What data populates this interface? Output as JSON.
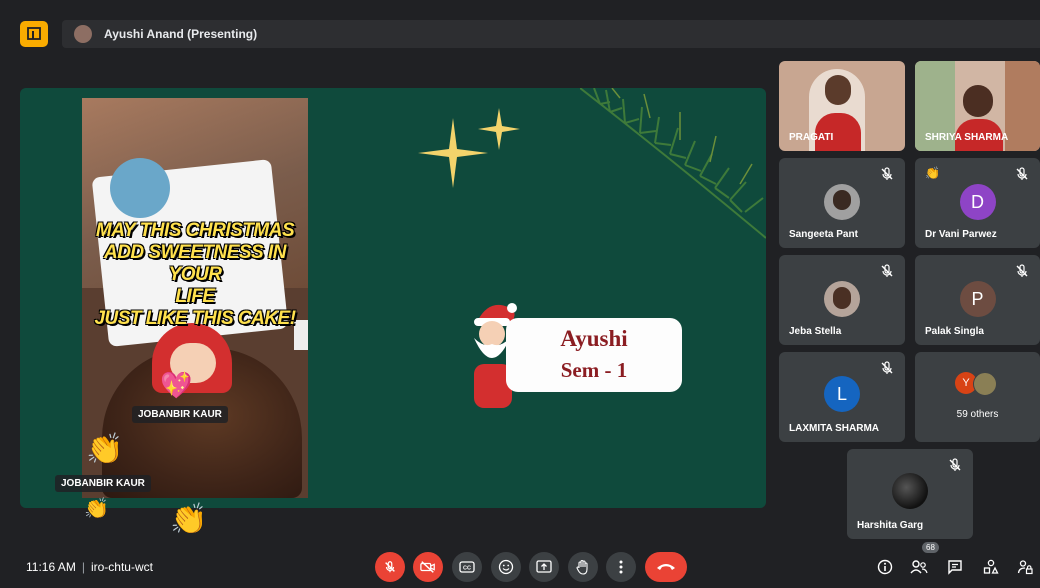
{
  "top": {
    "presenter_label": "Ayushi Anand (Presenting)"
  },
  "slide": {
    "message_lines": [
      "MAY THIS CHRISTMAS",
      "ADD SWEETNESS IN YOUR",
      "LIFE",
      "JUST LIKE THIS CAKE!"
    ],
    "card_line1": "Ayushi",
    "card_line2": "Sem - 1",
    "reaction_name_1": "JOBANBIR KAUR",
    "reaction_name_2": "JOBANBIR KAUR"
  },
  "participants": [
    {
      "name": "PRAGATI",
      "type": "video"
    },
    {
      "name": "SHRIYA SHARMA",
      "type": "video"
    },
    {
      "name": "Sangeeta Pant",
      "type": "photo",
      "muted": true
    },
    {
      "name": "Dr Vani Parwez",
      "type": "initial",
      "initial": "D",
      "color": "#8e44c6",
      "muted": true
    },
    {
      "name": "Jeba Stella",
      "type": "photo",
      "muted": true
    },
    {
      "name": "Palak Singla",
      "type": "initial",
      "initial": "P",
      "color": "#6d4c41",
      "muted": true
    },
    {
      "name": "LAXMITA SHARMA",
      "type": "initial",
      "initial": "L",
      "color": "#1565c0",
      "muted": true
    },
    {
      "name": "59 others",
      "type": "others",
      "initial": "Y",
      "color": "#d84315"
    },
    {
      "name": "Harshita Garg",
      "type": "photo",
      "muted": true
    }
  ],
  "bottom": {
    "time": "11:16 AM",
    "separator": "|",
    "meeting_code": "iro-chtu-wct",
    "people_count": "68"
  },
  "colors": {
    "slide_bg": "#0f4a3c",
    "danger": "#ea4335",
    "tile_bg": "#3c4043",
    "logo": "#f9ab00"
  }
}
